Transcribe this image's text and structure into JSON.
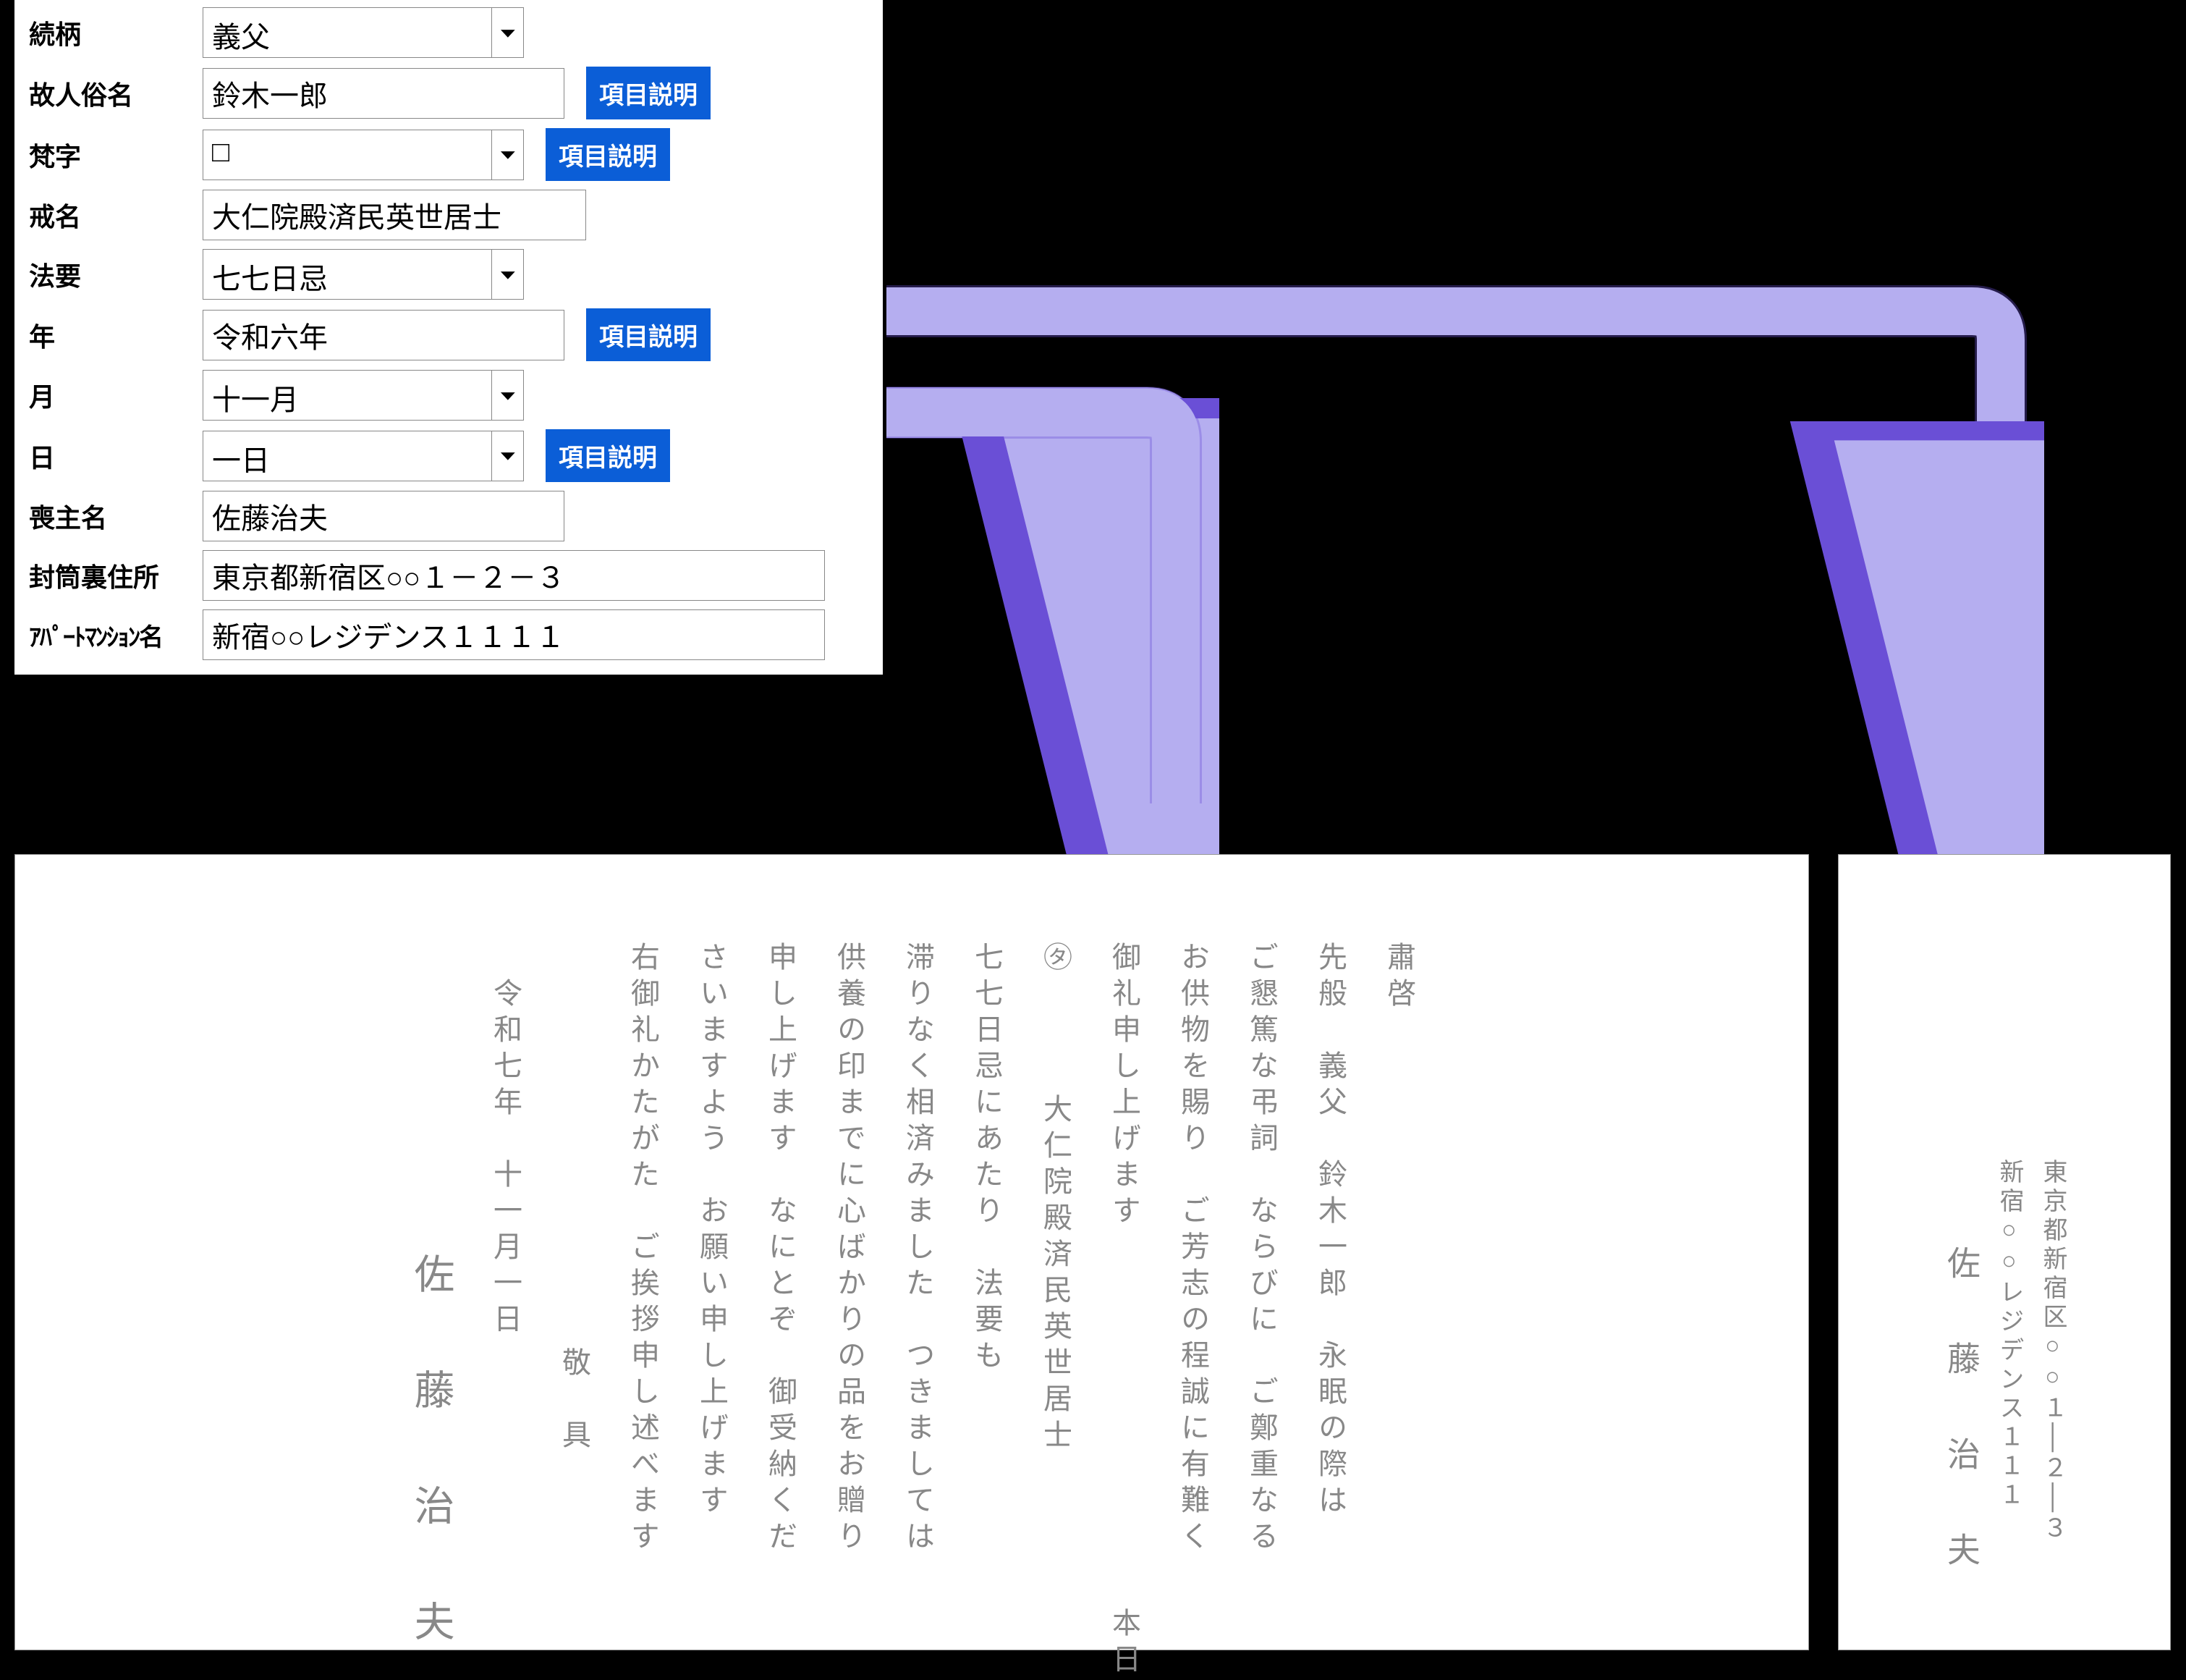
{
  "form": {
    "relation": {
      "label": "続柄",
      "value": "義父"
    },
    "deceased_name": {
      "label": "故人俗名",
      "value": "鈴木一郎"
    },
    "bonji": {
      "label": "梵字",
      "value": "□"
    },
    "kaimyo": {
      "label": "戒名",
      "value": "大仁院殿済民英世居士"
    },
    "houyou": {
      "label": "法要",
      "value": "七七日忌"
    },
    "year": {
      "label": "年",
      "value": "令和六年"
    },
    "month": {
      "label": "月",
      "value": "十一月"
    },
    "day": {
      "label": "日",
      "value": "一日"
    },
    "moshu": {
      "label": "喪主名",
      "value": "佐藤治夫"
    },
    "address": {
      "label": "封筒裏住所",
      "value": "東京都新宿区○○１－２－３"
    },
    "apartment": {
      "label": "ｱﾊﾟｰﾄﾏﾝｼｮﾝ名",
      "value": "新宿○○レジデンス１１１１"
    },
    "help_button": "項目説明"
  },
  "letter": {
    "l1": "肅啓",
    "l2": "先般　義父　鈴木一郎　永眠の際は",
    "l3": "ご懇篤な弔詞　ならびに　ご鄭重なる",
    "l4": "お供物を賜り　ご芳志の程誠に有難く",
    "l5": "御礼申し上げます",
    "l5tail": "本日",
    "l6a": "㋟",
    "l6b": "大仁院殿済民英世居士",
    "l7": "七七日忌にあたり　法要も",
    "l8": "滞りなく相済みました　つきましては",
    "l9": "供養の印までに心ばかりの品をお贈り",
    "l10": "申し上げます　なにとぞ　御受納くだ",
    "l11": "さいますよう　お願い申し上げます",
    "l12": "右御礼かたがた　ご挨拶申し述べます",
    "keigu": "敬　具",
    "date": "令和七年　十一月一日",
    "name": "佐　藤　治　夫"
  },
  "envelope": {
    "addr1": "東京都新宿区○○１│２│３",
    "addr2": "新宿○○レジデンス１１１",
    "name": "佐　藤　治　夫"
  }
}
